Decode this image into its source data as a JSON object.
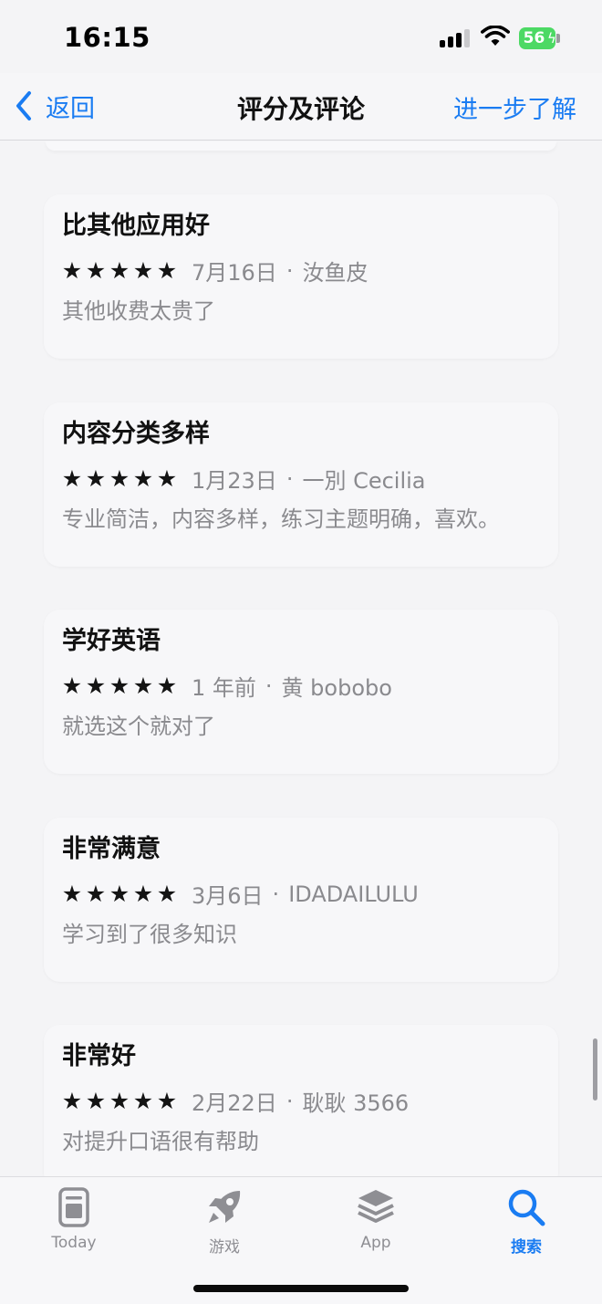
{
  "status_bar": {
    "time": "16:15",
    "battery": "56"
  },
  "nav": {
    "back_label": "返回",
    "title": "评分及评论",
    "more_label": "进一步了解"
  },
  "reviews": [
    {
      "title": "比其他应用好",
      "stars": "★★★★★",
      "rating": 5,
      "date": "7月16日",
      "dot": "·",
      "author": "汝鱼皮",
      "body": "其他收费太贵了"
    },
    {
      "title": "内容分类多样",
      "stars": "★★★★★",
      "rating": 5,
      "date": "1月23日",
      "dot": "·",
      "author": "一別 Cecilia",
      "body": "专业简洁，内容多样，练习主题明确，喜欢。"
    },
    {
      "title": "学好英语",
      "stars": "★★★★★",
      "rating": 5,
      "date": "1 年前",
      "dot": "·",
      "author": "黄 bobobo",
      "body": "就选这个就对了"
    },
    {
      "title": "非常满意",
      "stars": "★★★★★",
      "rating": 5,
      "date": "3月6日",
      "dot": "·",
      "author": "IDADAILULU",
      "body": "学习到了很多知识"
    },
    {
      "title": "非常好",
      "stars": "★★★★★",
      "rating": 5,
      "date": "2月22日",
      "dot": "·",
      "author": "耿耿 3566",
      "body": "对提升口语很有帮助"
    }
  ],
  "tab_bar": {
    "tabs": [
      {
        "label": "Today",
        "icon": "today-icon",
        "active": false
      },
      {
        "label": "游戏",
        "icon": "rocket-icon",
        "active": false
      },
      {
        "label": "App",
        "icon": "app-stack-icon",
        "active": false
      },
      {
        "label": "搜索",
        "icon": "search-icon",
        "active": true
      }
    ]
  },
  "colors": {
    "accent": "#1a7cf2",
    "secondary_text": "#8a8a8e",
    "battery": "#4cd964"
  }
}
